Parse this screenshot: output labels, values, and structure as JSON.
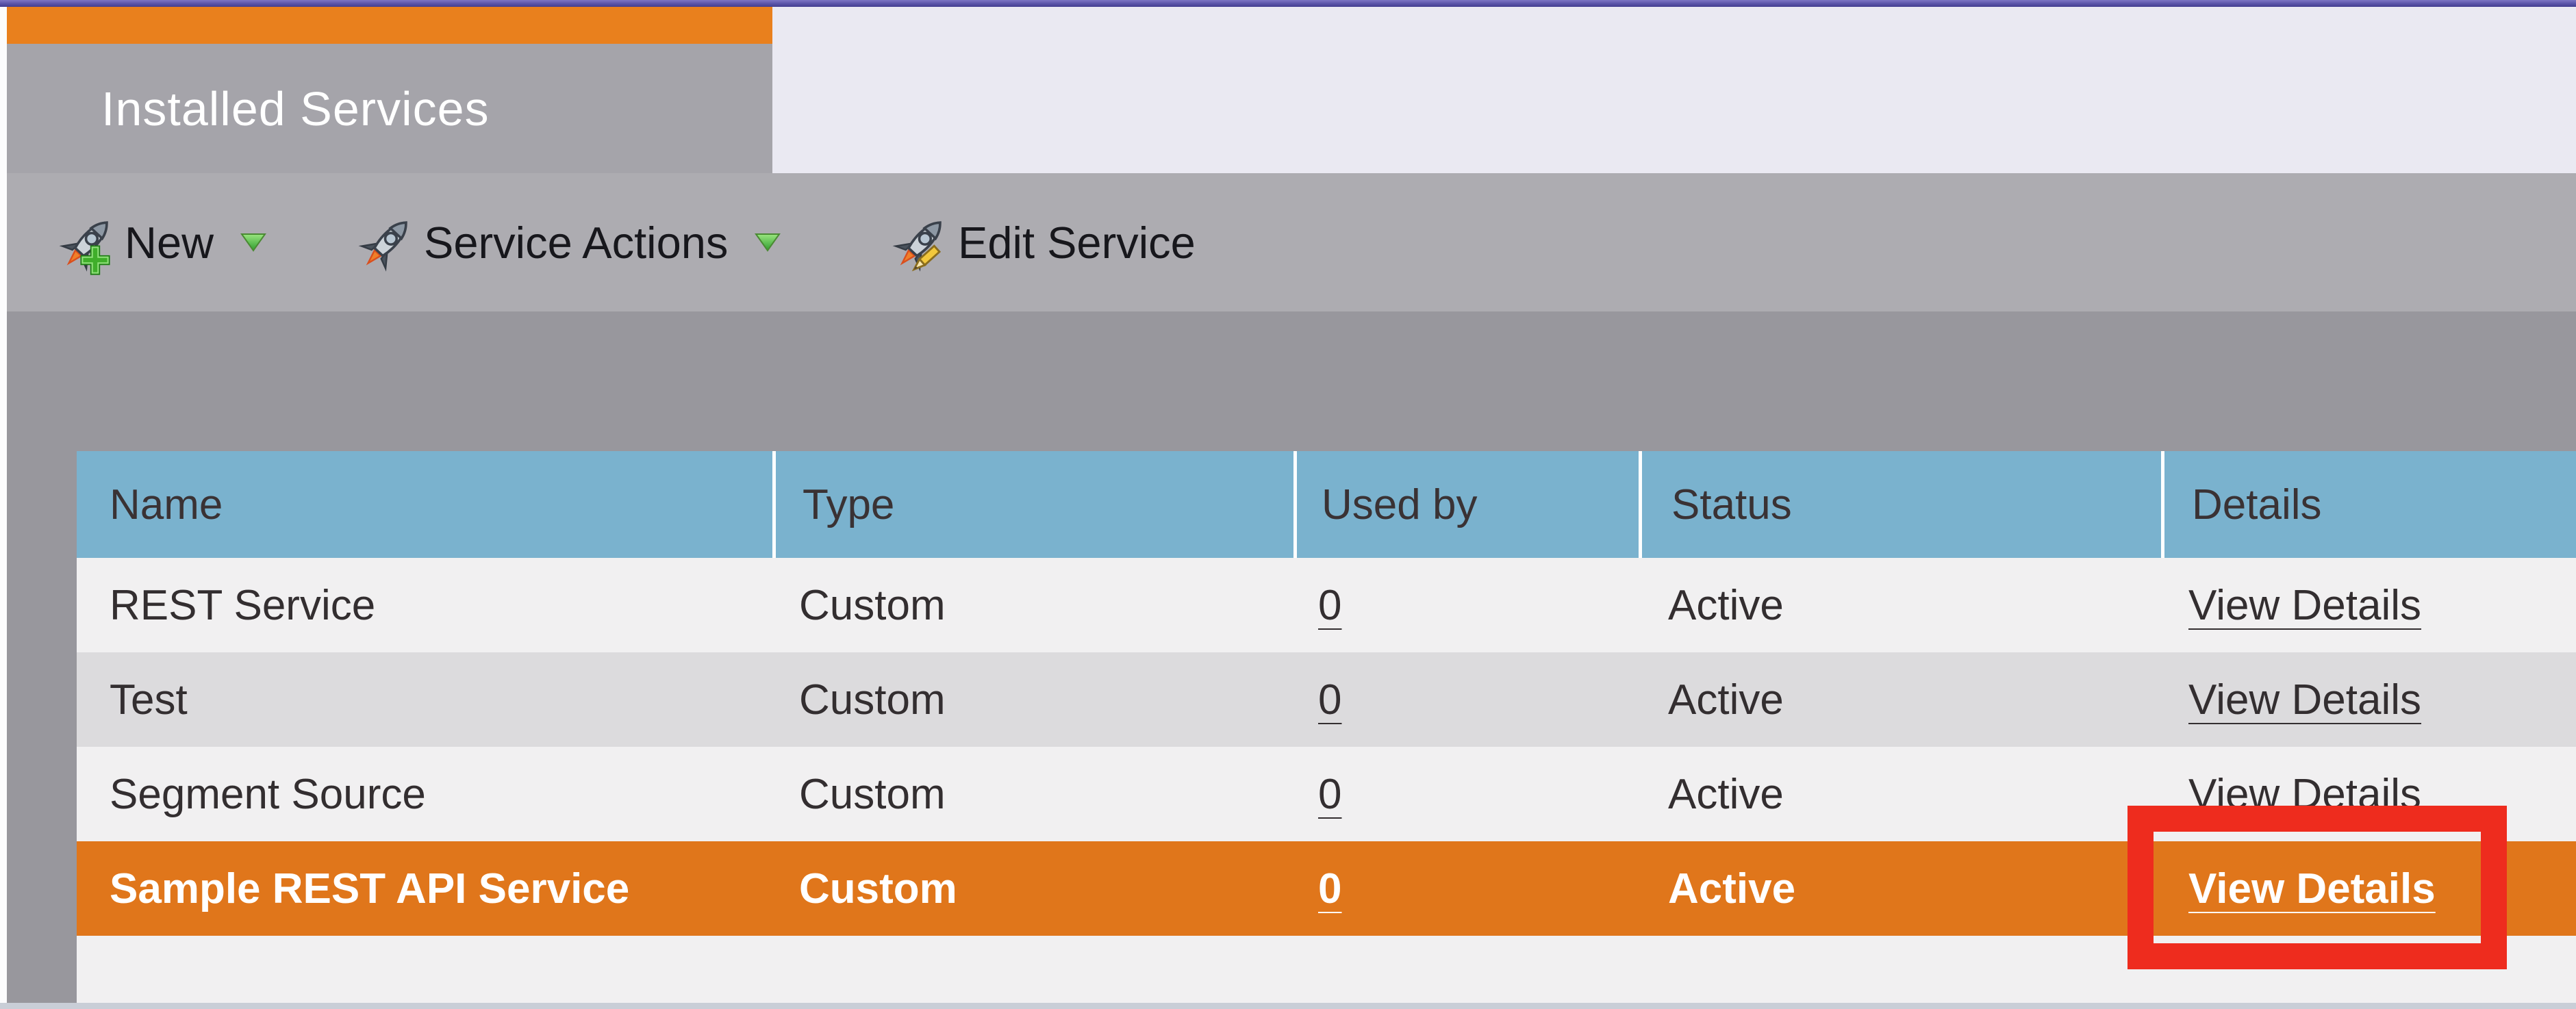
{
  "tab": {
    "title": "Installed Services"
  },
  "toolbar": {
    "items": [
      {
        "label": "New",
        "icon": "rocket-plus-icon",
        "has_dropdown": true
      },
      {
        "label": "Service Actions",
        "icon": "rocket-icon",
        "has_dropdown": true
      },
      {
        "label": "Edit Service",
        "icon": "rocket-pencil-icon",
        "has_dropdown": false
      }
    ]
  },
  "table": {
    "columns": [
      "Name",
      "Type",
      "Used by",
      "Status",
      "Details"
    ],
    "rows": [
      {
        "name": "REST Service",
        "type": "Custom",
        "used_by": "0",
        "status": "Active",
        "details": "View Details",
        "highlighted": false
      },
      {
        "name": "Test",
        "type": "Custom",
        "used_by": "0",
        "status": "Active",
        "details": "View Details",
        "highlighted": false
      },
      {
        "name": "Segment Source",
        "type": "Custom",
        "used_by": "0",
        "status": "Active",
        "details": "View Details",
        "highlighted": false
      },
      {
        "name": "Sample REST API Service",
        "type": "Custom",
        "used_by": "0",
        "status": "Active",
        "details": "View Details",
        "highlighted": true
      }
    ]
  },
  "annotation": {
    "type": "highlight-box",
    "target": "View Details link of highlighted row"
  },
  "colors": {
    "accent_orange": "#e0761b",
    "accent_orange_bright": "#e9801d",
    "header_blue": "#7ab2ce",
    "annotation_red": "#ee2c1e",
    "lavender": "#eae9f2",
    "tab_gray": "#a5a4aa",
    "toolbar_gray": "#adacb1",
    "content_gray": "#98979d"
  }
}
